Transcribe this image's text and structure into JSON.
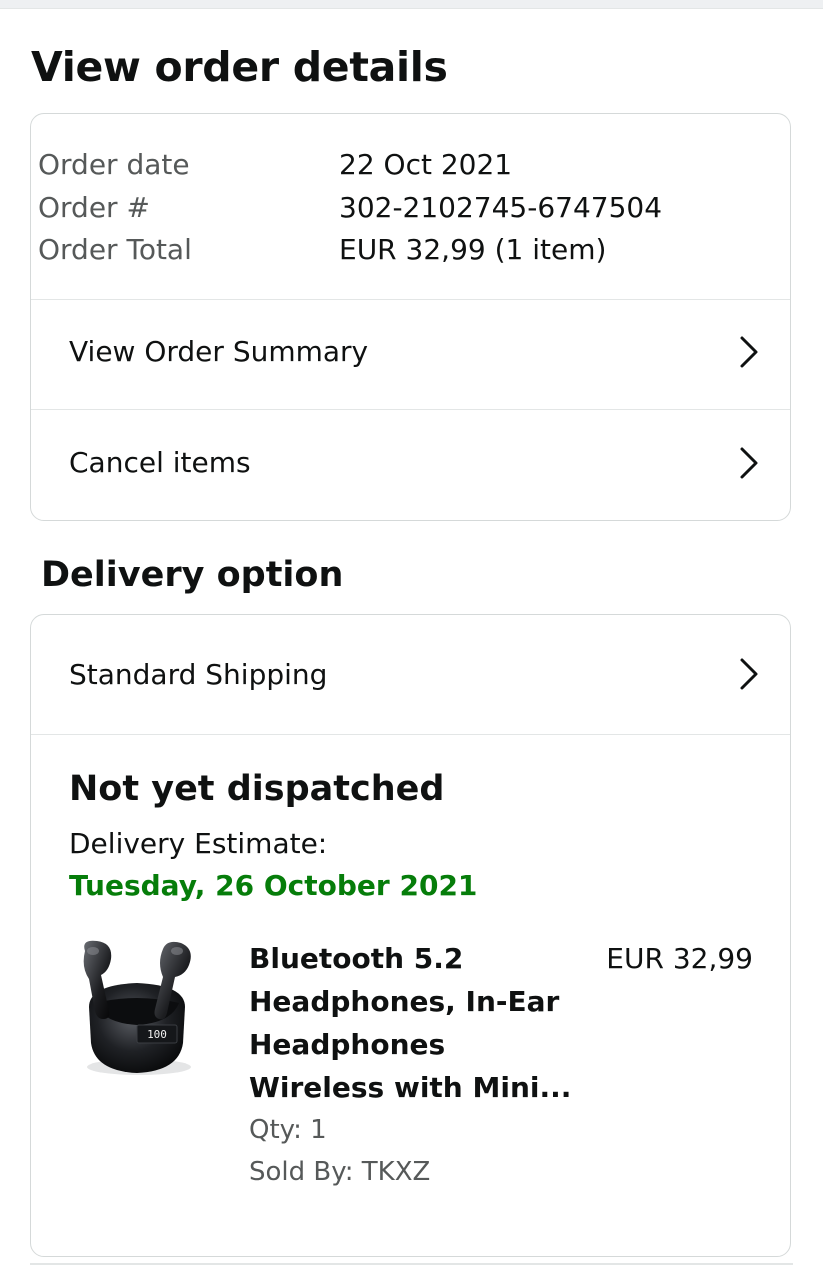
{
  "page": {
    "title": "View order details"
  },
  "order": {
    "date_label": "Order date",
    "date_value": "22 Oct 2021",
    "number_label": "Order #",
    "number_value": "302-2102745-6747504",
    "total_label": "Order Total",
    "total_value": "EUR 32,99 (1 item)",
    "summary_link": "View Order Summary",
    "cancel_link": "Cancel items"
  },
  "delivery": {
    "section_title": "Delivery option",
    "shipping_method": "Standard Shipping",
    "status": "Not yet dispatched",
    "estimate_label": "Delivery Estimate:",
    "estimate_date": "Tuesday, 26 October 2021",
    "estimate_color": "#067d0a"
  },
  "product": {
    "title": "Bluetooth 5.2 Headphones, In-Ear Headphones Wireless with Mini...",
    "price": "EUR 32,99",
    "qty": "Qty: 1",
    "sold_by": "Sold By: TKXZ",
    "image_display": "100"
  },
  "icons": {
    "chevron": "chevron-right-icon"
  }
}
